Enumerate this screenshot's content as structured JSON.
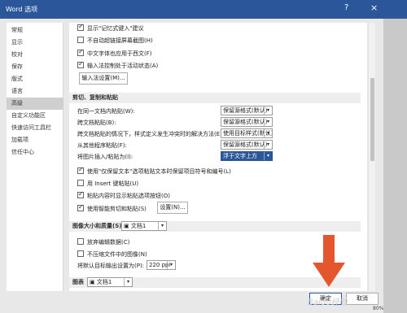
{
  "window": {
    "title": "Word 选项",
    "help_glyph": "?",
    "close_glyph": "×"
  },
  "sidebar": {
    "items": [
      {
        "label": "常规"
      },
      {
        "label": "显示"
      },
      {
        "label": "校对"
      },
      {
        "label": "保存"
      },
      {
        "label": "版式"
      },
      {
        "label": "语言"
      },
      {
        "label": "高级",
        "active": true
      },
      {
        "label": "自定义功能区"
      },
      {
        "label": "快速访问工具栏"
      },
      {
        "label": "加载项"
      },
      {
        "label": "信任中心"
      }
    ]
  },
  "ime_section": {
    "opt1": "显示\"记忆式键入\"建议",
    "opt2": "不自动超链接屏幕截图(H)",
    "opt3": "中文字体也应用于西文(F)",
    "opt4": "输入法控制处于活动状态(A)",
    "ime_button": "输入法设置(M)..."
  },
  "paste_section": {
    "title": "剪切、复制和粘贴",
    "rows": [
      {
        "label": "在同一文档内粘贴(W):",
        "value": "保留源格式(默认)"
      },
      {
        "label": "跨文档粘贴(B):",
        "value": "保留源格式(默认)"
      },
      {
        "label": "跨文档粘贴的情况下，样式定义发生冲突时的解决方法(E):",
        "value": "使用目标样式(默认)"
      },
      {
        "label": "从其他程序粘贴(F):",
        "value": "保留源格式(默认)"
      },
      {
        "label": "将图片插入/粘贴为(I):",
        "value": "浮于文字上方"
      }
    ],
    "opt_keep_bullets": "使用\"仅保留文本\"选项粘贴文本时保留项目符号和编号(L)",
    "opt_insert_key": "用 Insert 键粘贴(U)",
    "opt_show_paste_btn": "粘贴内容时显示粘贴选项按钮(O)",
    "opt_smart": "使用智能剪切和粘贴(S)",
    "settings_button": "设置(N)..."
  },
  "image_section": {
    "title": "图像大小和质量(S)",
    "doc_value": "文档1",
    "opt_discard": "放弃编辑数据(C)",
    "opt_no_compress": "不压缩文件中的图像(N)",
    "target_label": "将默认目标输出设置为(P):",
    "target_value": "220 ppi"
  },
  "chart_section": {
    "title": "图表",
    "doc_value": "文档1"
  },
  "footer": {
    "ok": "确定",
    "cancel": "取消"
  },
  "watermark": "Baidu经验",
  "status_zoom": "80%",
  "colors": {
    "titlebar": "#2b579a",
    "arrow": "#e4572e"
  }
}
